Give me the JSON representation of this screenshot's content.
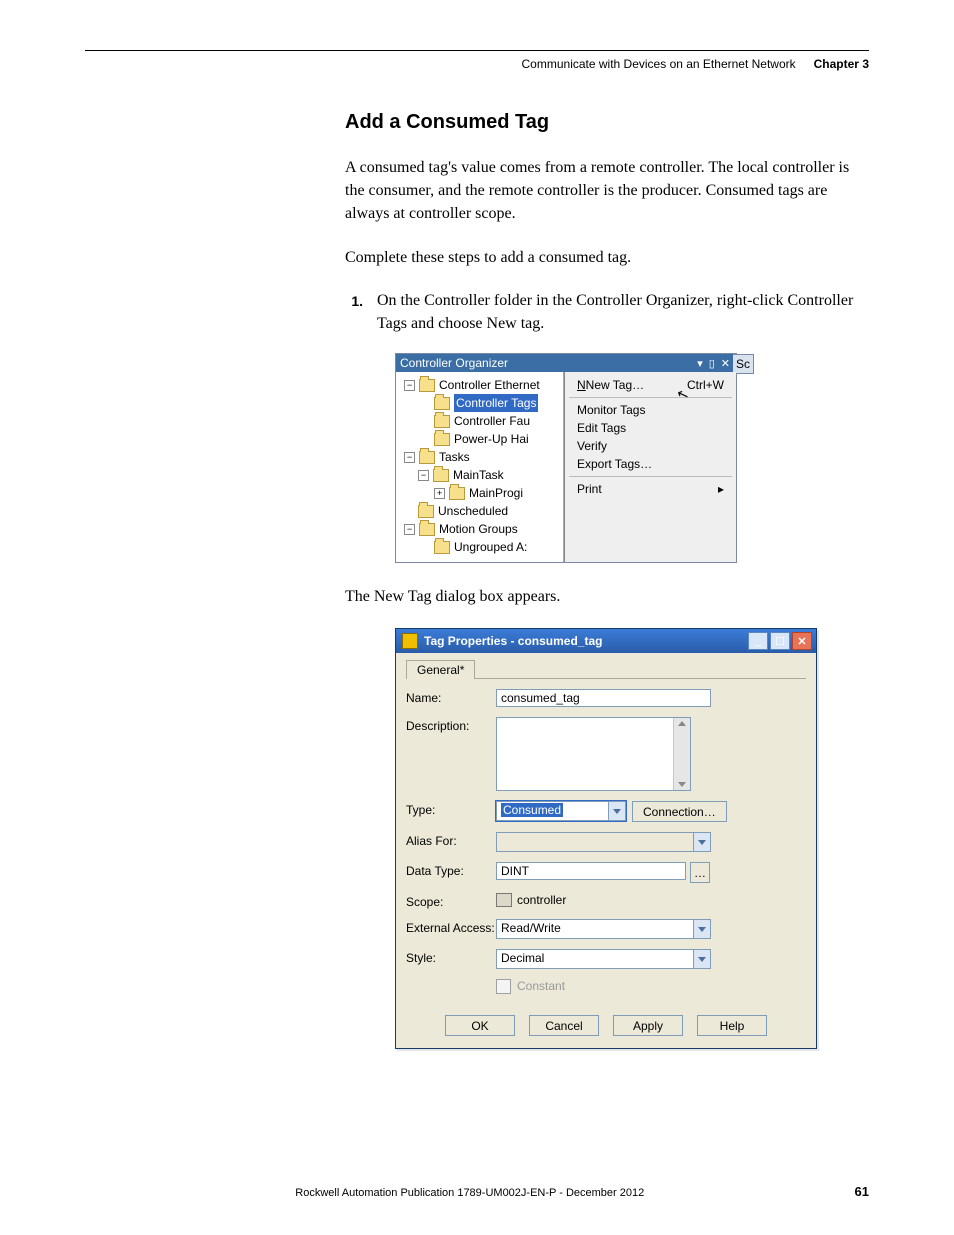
{
  "header": {
    "breadcrumb": "Communicate with Devices on an Ethernet Network",
    "chapter": "Chapter 3"
  },
  "title": "Add a Consumed Tag",
  "para1": "A consumed tag's value comes from a remote controller. The local controller is the consumer, and the remote controller is the producer. Consumed tags are always at controller scope.",
  "para2": "Complete these steps to add a consumed tag.",
  "step1_num": "1.",
  "step1_text": "On the Controller folder in the Controller Organizer, right-click Controller Tags and choose New tag.",
  "organizer": {
    "title": "Controller Organizer",
    "side_s": "Sc",
    "tree": {
      "ethernet": "Controller Ethernet",
      "tags": "Controller Tags",
      "fault": "Controller Fau",
      "powerup": "Power-Up Hai",
      "tasks": "Tasks",
      "maintask": "MainTask",
      "mainprog": "MainProgi",
      "unsched": "Unscheduled",
      "motion": "Motion Groups",
      "ungrouped": "Ungrouped A:"
    },
    "menu": {
      "new_tag": "New Tag…",
      "new_tag_accel": "Ctrl+W",
      "monitor": "Monitor Tags",
      "edit": "Edit Tags",
      "verify": "Verify",
      "export": "Export Tags…",
      "print": "Print"
    }
  },
  "para3": "The New Tag dialog box appears.",
  "dialog": {
    "title": "Tag Properties - consumed_tag",
    "tab": "General*",
    "labels": {
      "name": "Name:",
      "description": "Description:",
      "type": "Type:",
      "alias": "Alias For:",
      "datatype": "Data Type:",
      "scope": "Scope:",
      "extaccess": "External Access:",
      "style": "Style:",
      "constant": "Constant"
    },
    "values": {
      "name": "consumed_tag",
      "type": "Consumed",
      "connection_btn": "Connection…",
      "datatype": "DINT",
      "scope": "controller",
      "extaccess": "Read/Write",
      "style": "Decimal"
    },
    "buttons": {
      "ok": "OK",
      "cancel": "Cancel",
      "apply": "Apply",
      "help": "Help"
    }
  },
  "footer": {
    "publication": "Rockwell Automation Publication 1789-UM002J-EN-P - December 2012",
    "page": "61"
  }
}
